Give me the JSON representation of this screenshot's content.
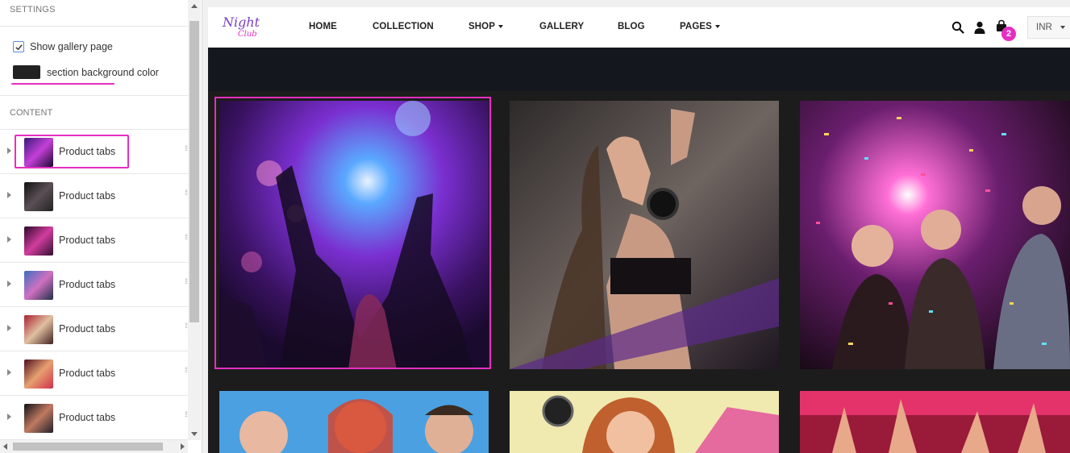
{
  "editor": {
    "settings_title": "SETTINGS",
    "show_gallery_label": "Show gallery page",
    "show_gallery_checked": true,
    "section_bg_label": "section background color",
    "section_bg_color": "#222222",
    "content_title": "CONTENT",
    "blocks": [
      {
        "label": "Product tabs"
      },
      {
        "label": "Product tabs"
      },
      {
        "label": "Product tabs"
      },
      {
        "label": "Product tabs"
      },
      {
        "label": "Product tabs"
      },
      {
        "label": "Product tabs"
      },
      {
        "label": "Product tabs"
      }
    ]
  },
  "site": {
    "logo_text": "Night Club",
    "nav": [
      {
        "label": "HOME"
      },
      {
        "label": "COLLECTION"
      },
      {
        "label": "SHOP",
        "dropdown": true
      },
      {
        "label": "GALLERY"
      },
      {
        "label": "BLOG"
      },
      {
        "label": "PAGES",
        "dropdown": true
      }
    ],
    "cart_count": "2",
    "currency": "INR",
    "icons": [
      "search-icon",
      "user-icon",
      "cart-icon"
    ],
    "accent_color": "#e62ec2"
  }
}
